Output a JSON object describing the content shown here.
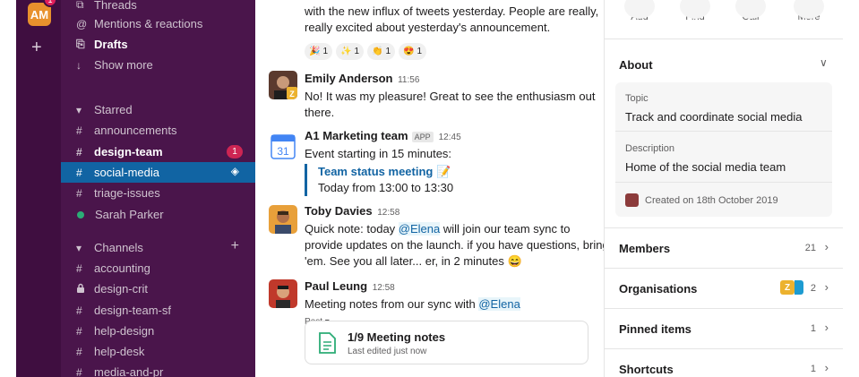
{
  "workspace": {
    "initials": "AM",
    "badge": "1"
  },
  "sidebar": {
    "top_items": [
      {
        "label": "Threads",
        "icon": "threads-icon"
      },
      {
        "label": "Mentions & reactions",
        "icon": "at-icon"
      },
      {
        "label": "Drafts",
        "icon": "drafts-icon"
      },
      {
        "label": "Show more",
        "icon": "arrow-down-icon"
      }
    ],
    "starred_header": "Starred",
    "starred": [
      {
        "label": "announcements"
      },
      {
        "label": "design-team",
        "count": "1"
      },
      {
        "label": "social-media"
      },
      {
        "label": "triage-issues"
      },
      {
        "label": "Sarah Parker"
      }
    ],
    "channels_header": "Channels",
    "channels": [
      {
        "label": "accounting"
      },
      {
        "label": "design-crit"
      },
      {
        "label": "design-team-sf"
      },
      {
        "label": "help-design"
      },
      {
        "label": "help-desk"
      },
      {
        "label": "media-and-pr"
      }
    ]
  },
  "messages": {
    "partial": {
      "line1": "with the new influx of tweets yesterday. People are really,",
      "line2": "really excited about yesterday's announcement.",
      "reactions": [
        {
          "emoji": "🎉",
          "count": "1"
        },
        {
          "emoji": "✨",
          "count": "1"
        },
        {
          "emoji": "👏",
          "count": "1"
        },
        {
          "emoji": "😍",
          "count": "1"
        }
      ]
    },
    "emily": {
      "name": "Emily Anderson",
      "time": "11:56",
      "text": "No! It was my pleasure! Great to see the enthusiasm out there."
    },
    "a1": {
      "name": "A1 Marketing team",
      "badge": "APP",
      "time": "12:45",
      "calendar_day": "31",
      "text": "Event starting in 15 minutes:",
      "event_title": "Team status meeting",
      "event_time": "Today from 13:00 to 13:30"
    },
    "toby": {
      "name": "Toby Davies",
      "time": "12:58",
      "text_a": "Quick note: today ",
      "mention": "@Elena",
      "text_b": " will join our team sync to provide updates on the launch. if you have questions, bring 'em. See you all later... er, in 2 minutes 😄"
    },
    "paul": {
      "name": "Paul Leung",
      "time": "12:58",
      "text_a": "Meeting notes from our sync with ",
      "mention": "@Elena",
      "post_label": "Post ▾",
      "post_title": "1/9 Meeting notes",
      "post_sub": "Last edited just now"
    }
  },
  "details": {
    "actions": [
      "Add",
      "Find",
      "Call",
      "More"
    ],
    "about_title": "About",
    "topic_label": "Topic",
    "topic_value": "Track and coordinate social media",
    "description_label": "Description",
    "description_value": "Home of the social media team",
    "created": "Created on 18th October 2019",
    "members_label": "Members",
    "members_count": "21",
    "orgs_label": "Organisations",
    "orgs_count": "2",
    "pinned_label": "Pinned items",
    "pinned_count": "1",
    "shortcuts_label": "Shortcuts",
    "shortcuts_count": "1"
  },
  "colors": {
    "sidebar": "#4a154b",
    "rail": "#3f0e40",
    "active": "#1164a3",
    "badge": "#cd2553",
    "link": "#1264a3"
  }
}
